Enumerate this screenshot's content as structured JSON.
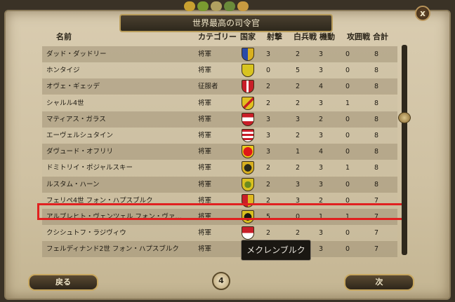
{
  "dialog": {
    "title": "世界最高の司令官",
    "close_label": "x",
    "back_label": "戻る",
    "next_label": "次",
    "page_number": "4",
    "tooltip": "メクレンブルク"
  },
  "colors": {
    "highlight": "#e02020",
    "parchment": "#d4c6a8",
    "title_bar": "#3a3226"
  },
  "top_icons": [
    "crown-icon",
    "shield-icon",
    "helmet-icon",
    "cannon-icon",
    "horse-icon"
  ],
  "headers": {
    "name": "名前",
    "category": "カテゴリー",
    "country": "国家",
    "fire": "射撃",
    "shock": "白兵戦",
    "maneuver": "機動",
    "siege": "攻囲戦",
    "total": "合計"
  },
  "rows": [
    {
      "name": "ダッド・ダッドリー",
      "category": "将軍",
      "flag": "flag-england-icon",
      "fire": "3",
      "shock": "2",
      "maneuver": "3",
      "siege": "0",
      "total": "8"
    },
    {
      "name": "ホンタイジ",
      "category": "将軍",
      "flag": "flag-manchu-icon",
      "fire": "0",
      "shock": "5",
      "maneuver": "3",
      "siege": "0",
      "total": "8"
    },
    {
      "name": "オヴェ・ギェッデ",
      "category": "征服者",
      "flag": "flag-denmark-icon",
      "fire": "2",
      "shock": "2",
      "maneuver": "4",
      "siege": "0",
      "total": "8"
    },
    {
      "name": "シャルル4世",
      "category": "将軍",
      "flag": "flag-lorraine-icon",
      "fire": "2",
      "shock": "2",
      "maneuver": "3",
      "siege": "1",
      "total": "8"
    },
    {
      "name": "マティアス・ガラス",
      "category": "将軍",
      "flag": "flag-austria-icon",
      "fire": "3",
      "shock": "3",
      "maneuver": "2",
      "siege": "0",
      "total": "8"
    },
    {
      "name": "エーヴェルシュタイン",
      "category": "将軍",
      "flag": "flag-hesse-icon",
      "fire": "3",
      "shock": "2",
      "maneuver": "3",
      "siege": "0",
      "total": "8"
    },
    {
      "name": "ダヴュード・オフリリ",
      "category": "将軍",
      "flag": "flag-georgia-icon",
      "fire": "3",
      "shock": "1",
      "maneuver": "4",
      "siege": "0",
      "total": "8"
    },
    {
      "name": "ドミトリイ・ポジャルスキー",
      "category": "将軍",
      "flag": "flag-russia-icon",
      "fire": "2",
      "shock": "2",
      "maneuver": "3",
      "siege": "1",
      "total": "8"
    },
    {
      "name": "ルスタム・ハーン",
      "category": "将軍",
      "flag": "flag-kartli-icon",
      "fire": "2",
      "shock": "3",
      "maneuver": "3",
      "siege": "0",
      "total": "8"
    },
    {
      "name": "フェリペ4世 フォン・ハプスブルク",
      "category": "将軍",
      "flag": "flag-spain-icon",
      "fire": "2",
      "shock": "3",
      "maneuver": "2",
      "siege": "0",
      "total": "7"
    },
    {
      "name": "アルブレヒト・ヴェンツェル フォン・ヴァ…",
      "category": "将軍",
      "flag": "flag-mecklenburg-icon",
      "fire": "5",
      "shock": "0",
      "maneuver": "1",
      "siege": "1",
      "total": "7"
    },
    {
      "name": "クシシュトフ・ラジヴィウ",
      "category": "将軍",
      "flag": "flag-poland-icon",
      "fire": "2",
      "shock": "2",
      "maneuver": "3",
      "siege": "0",
      "total": "7"
    },
    {
      "name": "フェルディナンド2世 フォン・ハプスブルク",
      "category": "将軍",
      "flag": "flag-austria-icon",
      "fire": "",
      "shock": "",
      "maneuver": "3",
      "siege": "0",
      "total": "7"
    }
  ]
}
